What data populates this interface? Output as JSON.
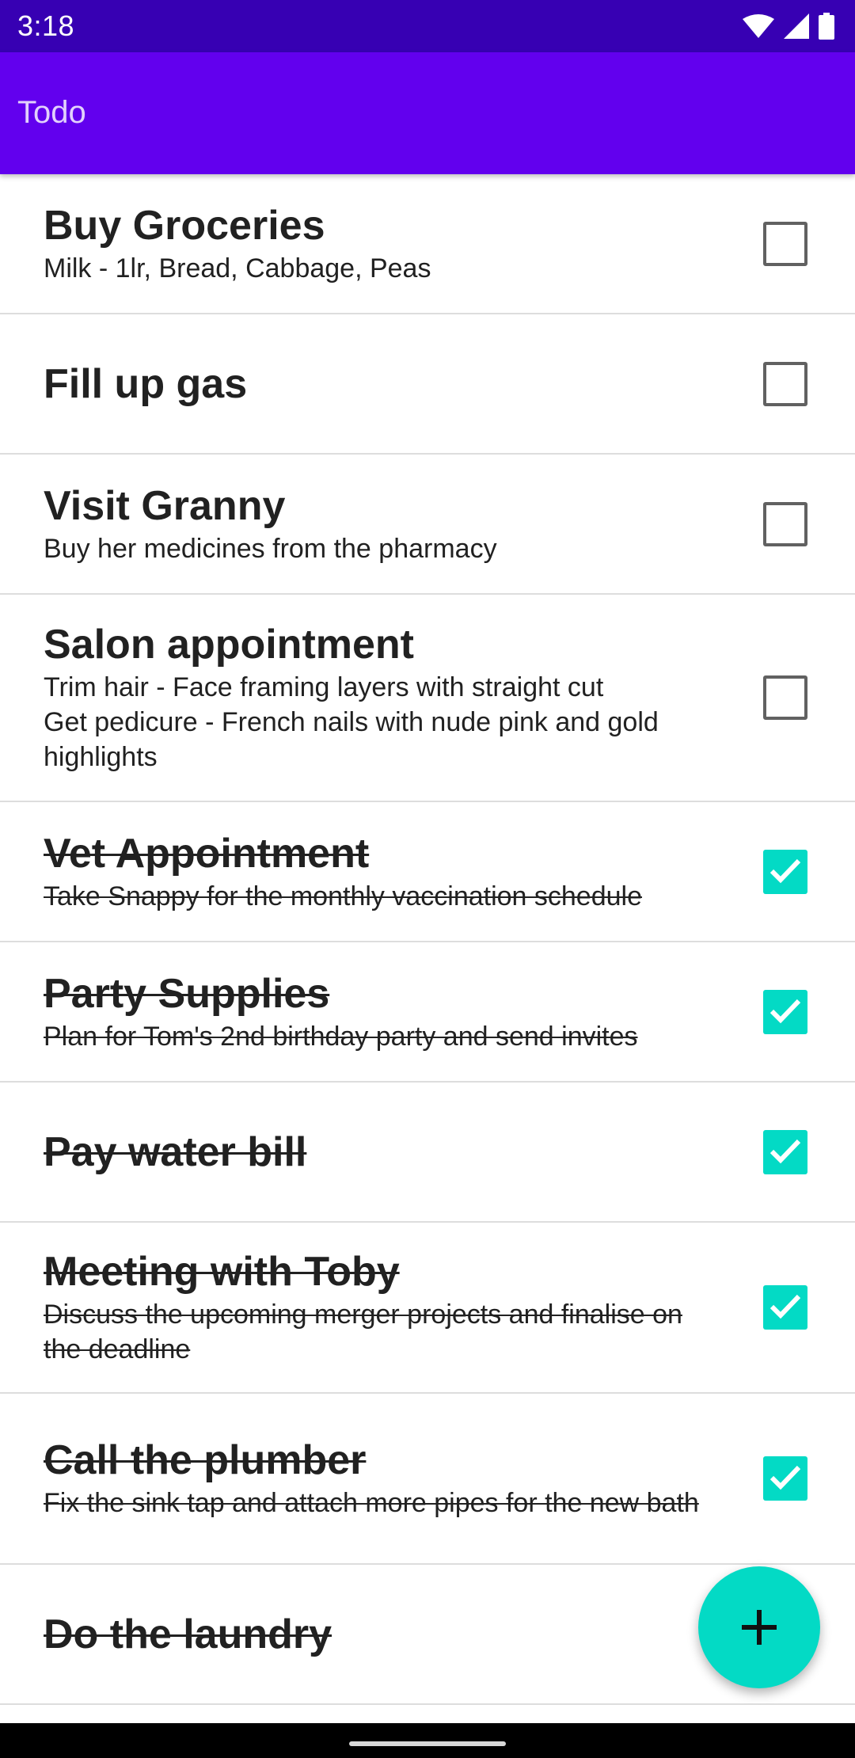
{
  "status_bar": {
    "time": "3:18",
    "icons": [
      "wifi-icon",
      "cellular-signal-icon",
      "battery-icon"
    ]
  },
  "app_bar": {
    "title": "Todo"
  },
  "colors": {
    "primary": "#6200ee",
    "primary_dark": "#3700b3",
    "accent": "#03dac5"
  },
  "todos": [
    {
      "title": "Buy Groceries",
      "description": "Milk - 1lr, Bread, Cabbage, Peas",
      "checked": false
    },
    {
      "title": "Fill up gas",
      "description": "",
      "checked": false
    },
    {
      "title": "Visit Granny",
      "description": "Buy her medicines from the pharmacy",
      "checked": false
    },
    {
      "title": "Salon appointment",
      "description": "Trim hair - Face framing layers with straight cut\nGet pedicure - French nails with nude pink and gold highlights",
      "checked": false
    },
    {
      "title": "Vet Appointment",
      "description": "Take Snappy for the monthly vaccination schedule",
      "checked": true
    },
    {
      "title": "Party Supplies",
      "description": "Plan for Tom's 2nd birthday party and send invites",
      "checked": true
    },
    {
      "title": "Pay water bill",
      "description": "",
      "checked": true
    },
    {
      "title": "Meeting with Toby",
      "description": "Discuss the upcoming merger projects and finalise on the deadline",
      "checked": true
    },
    {
      "title": "Call the plumber",
      "description": "Fix the sink tap and attach more pipes for the new bath",
      "checked": true
    },
    {
      "title": "Do the laundry",
      "description": "",
      "checked": true
    }
  ],
  "fab": {
    "icon": "add-icon"
  }
}
